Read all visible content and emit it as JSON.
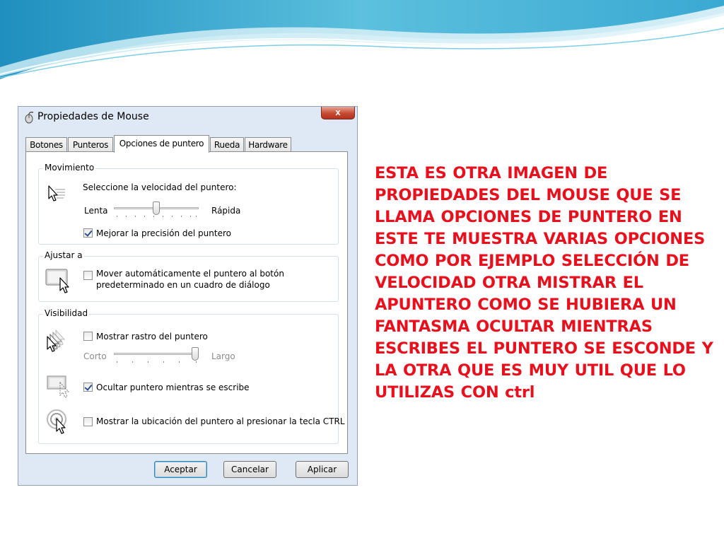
{
  "window": {
    "title": "Propiedades de Mouse",
    "close_label": "x"
  },
  "tabs": [
    {
      "label": "Botones"
    },
    {
      "label": "Punteros"
    },
    {
      "label": "Opciones de puntero",
      "active": true
    },
    {
      "label": "Rueda"
    },
    {
      "label": "Hardware"
    }
  ],
  "movimiento": {
    "group_label": "Movimiento",
    "prompt": "Seleccione la velocidad del puntero:",
    "slow_label": "Lenta",
    "fast_label": "Rápida",
    "speed_value": 0.5,
    "precision_label": "Mejorar la precisión del puntero",
    "precision_checked": true
  },
  "ajustar": {
    "group_label": "Ajustar a",
    "snap_line1": "Mover automáticamente el puntero al botón",
    "snap_line2": "predeterminado en un cuadro de diálogo",
    "snap_checked": false
  },
  "visibilidad": {
    "group_label": "Visibilidad",
    "trails_label": "Mostrar rastro del puntero",
    "trails_checked": false,
    "short_label": "Corto",
    "long_label": "Largo",
    "trail_length_value": 1.0,
    "hide_label": "Ocultar puntero mientras se escribe",
    "hide_checked": true,
    "ctrl_label": "Mostrar la ubicación del puntero al presionar la tecla CTRL",
    "ctrl_checked": false
  },
  "buttons": {
    "ok": "Aceptar",
    "cancel": "Cancelar",
    "apply": "Aplicar"
  },
  "note": {
    "text": "ESTA ES OTRA IMAGEN DE PROPIEDADES DEL MOUSE QUE SE LLAMA OPCIONES DE PUNTERO EN ESTE TE MUESTRA VARIAS OPCIONES COMO POR EJEMPLO SELECCIÓN DE VELOCIDAD OTRA MISTRAR EL APUNTERO COMO SE HUBIERA UN FANTASMA OCULTAR MIENTRAS ESCRIBES EL PUNTERO SE ESCONDE Y LA OTRA QUE ES MUY UTIL QUE LO UTILIZAS CON ctrl",
    "color": "#e8101c"
  },
  "theme": {
    "wave_dark": "#4aa3c9",
    "wave_light": "#a9dcec"
  }
}
